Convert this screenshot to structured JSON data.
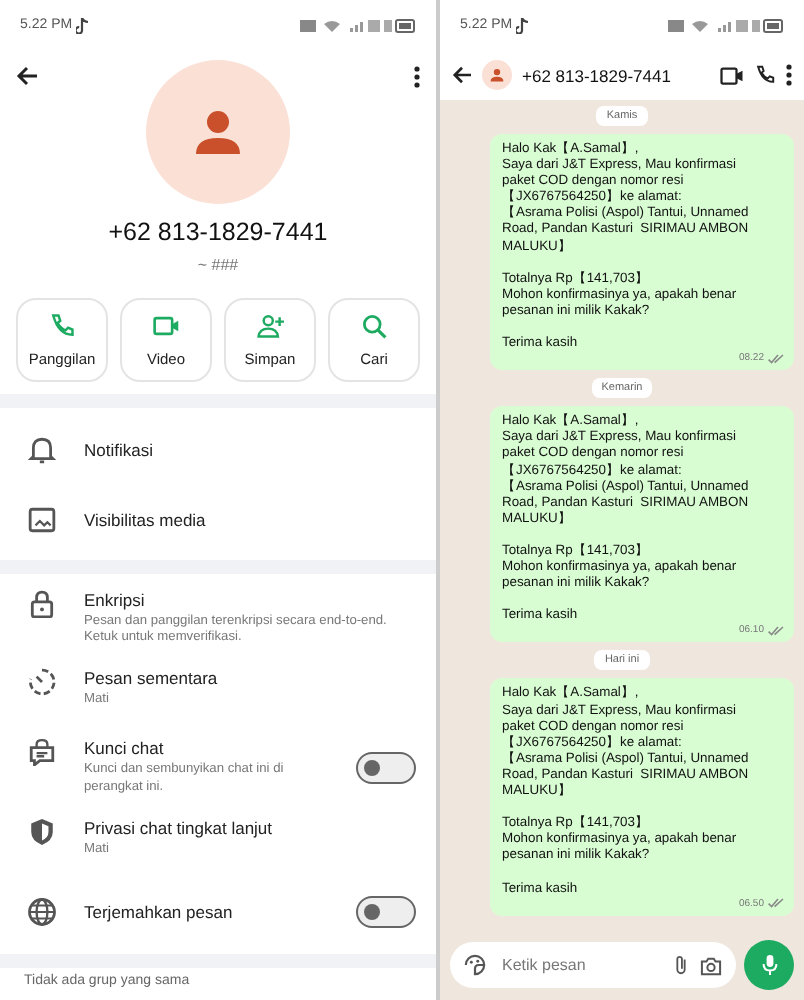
{
  "contact_info": {
    "status_bar": {
      "time": "5.22 PM"
    },
    "phone_number": "+62 813-1829-7441",
    "about": "~ ###",
    "actions": [
      {
        "label": "Panggilan"
      },
      {
        "label": "Video"
      },
      {
        "label": "Simpan"
      },
      {
        "label": "Cari"
      }
    ],
    "sections": [
      {
        "items": [
          {
            "kind": "row",
            "title": "Notifikasi"
          },
          {
            "kind": "row",
            "title": "Visibilitas media"
          }
        ]
      },
      {
        "items": [
          {
            "kind": "row",
            "title": "Enkripsi",
            "subtitle": "Pesan dan panggilan terenkripsi secara end-to-end. Ketuk untuk memverifikasi."
          },
          {
            "kind": "row",
            "title": "Pesan sementara",
            "subtitle": "Mati"
          },
          {
            "kind": "toggle",
            "title": "Kunci chat",
            "subtitle": "Kunci dan sembunyikan chat ini di perangkat ini.",
            "on": false
          },
          {
            "kind": "row",
            "title": "Privasi chat tingkat lanjut",
            "subtitle": "Mati"
          },
          {
            "kind": "toggle",
            "title": "Terjemahkan pesan",
            "on": false
          }
        ]
      }
    ],
    "footer": "Tidak ada grup yang sama"
  },
  "chat": {
    "status_bar": {
      "time": "5.22 PM"
    },
    "header": {
      "title": "+62 813-1829-7441"
    },
    "messages": [
      {
        "date": "Kamis",
        "text": "Halo Kak【A.Samal】,\nSaya dari J&T Express, Mau konfirmasi\npaket COD dengan nomor resi\n【JX6767564250】ke alamat:\n【Asrama Polisi (Aspol) Tantui, Unnamed\nRoad, Pandan Kasturi  SIRIMAU AMBON\nMALUKU】\n\nTotalnya Rp【141,703】\nMohon konfirmasinya ya, apakah benar\npesanan ini milik Kakak?\n\nTerima kasih",
        "time": "08.22"
      },
      {
        "date": "Kemarin",
        "text": "Halo Kak【A.Samal】,\nSaya dari J&T Express, Mau konfirmasi\npaket COD dengan nomor resi\n【JX6767564250】ke alamat:\n【Asrama Polisi (Aspol) Tantui, Unnamed\nRoad, Pandan Kasturi  SIRIMAU AMBON\nMALUKU】\n\nTotalnya Rp【141,703】\nMohon konfirmasinya ya, apakah benar\npesanan ini milik Kakak?\n\nTerima kasih",
        "time": "06.10"
      },
      {
        "date": "Hari ini",
        "text": "Halo Kak【A.Samal】,\nSaya dari J&T Express, Mau konfirmasi\npaket COD dengan nomor resi\n【JX6767564250】ke alamat:\n【Asrama Polisi (Aspol) Tantui, Unnamed\nRoad, Pandan Kasturi  SIRIMAU AMBON\nMALUKU】\n\nTotalnya Rp【141,703】\nMohon konfirmasinya ya, apakah benar\npesanan ini milik Kakak?\n\nTerima kasih",
        "time": "06.50"
      }
    ],
    "composer": {
      "placeholder": "Ketik pesan"
    }
  }
}
